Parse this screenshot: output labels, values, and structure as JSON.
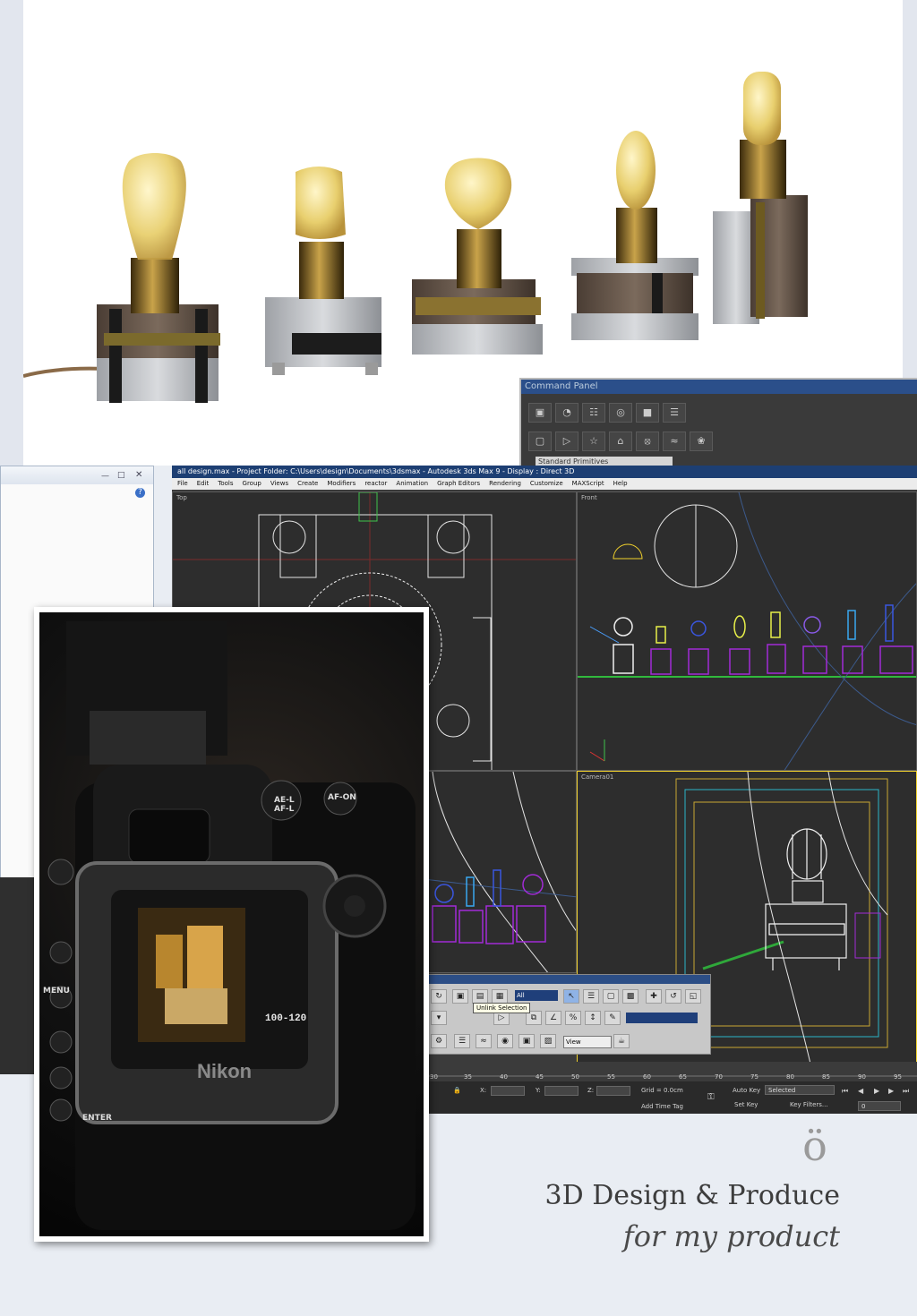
{
  "render": {
    "caption": ""
  },
  "command_panel": {
    "title": "Command Panel",
    "dropdown_value": "Standard Primitives",
    "row1_icons": [
      "▣",
      "◔",
      "☷",
      "◎",
      "■",
      "☰"
    ],
    "row2_icons": [
      "▢",
      "▷",
      "☆",
      "⌂",
      "⦻",
      "≈",
      "❀"
    ]
  },
  "max_window": {
    "title": "all design.max    - Project Folder: C:\\Users\\design\\Documents\\3dsmax    - Autodesk 3ds Max 9    - Display : Direct 3D",
    "menu": [
      "File",
      "Edit",
      "Tools",
      "Group",
      "Views",
      "Create",
      "Modifiers",
      "reactor",
      "Animation",
      "Graph Editors",
      "Rendering",
      "Customize",
      "MAXScript",
      "Help"
    ],
    "viewports": {
      "top": "Top",
      "front": "Front",
      "camera": "Camera01"
    }
  },
  "floating_toolbar": {
    "filter_value": "All",
    "tooltip": "Unlink Selection",
    "view_value": "View"
  },
  "timeline": {
    "ticks": [
      "30",
      "35",
      "40",
      "45",
      "50",
      "55",
      "60",
      "65",
      "70",
      "75",
      "80",
      "85",
      "90",
      "95"
    ]
  },
  "status": {
    "x_label": "X:",
    "y_label": "Y:",
    "z_label": "Z:",
    "grid": "Grid = 0.0cm",
    "add_time_tag": "Add Time Tag",
    "auto_key": "Auto Key",
    "selected": "Selected",
    "set_key": "Set Key",
    "key_filters": "Key Filters...",
    "frame": "0"
  },
  "camera_photo": {
    "brand": "Nikon",
    "lcd_text": "100-120",
    "labels": [
      "AE-L AF-L",
      "AF-ON",
      "MENU",
      "ENTER"
    ]
  },
  "branding": {
    "mark": "ö",
    "title": "3D Design & Produce",
    "subtitle": "for my product"
  }
}
